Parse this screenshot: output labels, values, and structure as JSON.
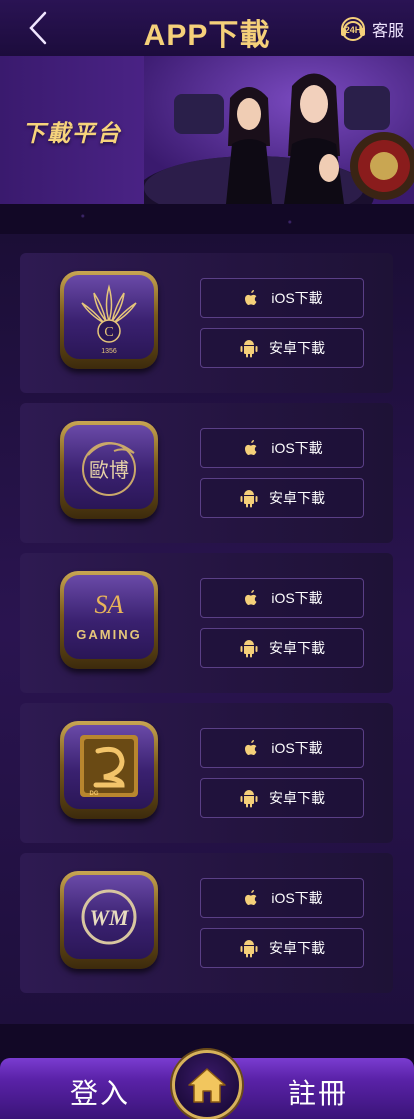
{
  "header": {
    "title": "APP下載",
    "service_label": "客服",
    "service_badge": "24H"
  },
  "banner": {
    "title": "下載平台"
  },
  "platforms": [
    {
      "logo": "c1356-logo",
      "logo_text": "1356",
      "ios_label": "iOS下載",
      "android_label": "安卓下載"
    },
    {
      "logo": "ou-bo-logo",
      "logo_text": "歐博",
      "ios_label": "iOS下載",
      "android_label": "安卓下載"
    },
    {
      "logo": "sa-gaming-logo",
      "logo_text": "GAMING",
      "ios_label": "iOS下載",
      "android_label": "安卓下載"
    },
    {
      "logo": "dg-logo",
      "logo_text": "DG",
      "ios_label": "iOS下載",
      "android_label": "安卓下載"
    },
    {
      "logo": "wm-logo",
      "logo_text": "WM",
      "ios_label": "iOS下載",
      "android_label": "安卓下載"
    }
  ],
  "tabbar": {
    "login_label": "登入",
    "register_label": "註冊"
  },
  "colors": {
    "gold": "#f5d07a",
    "purple": "#5a22a8"
  }
}
